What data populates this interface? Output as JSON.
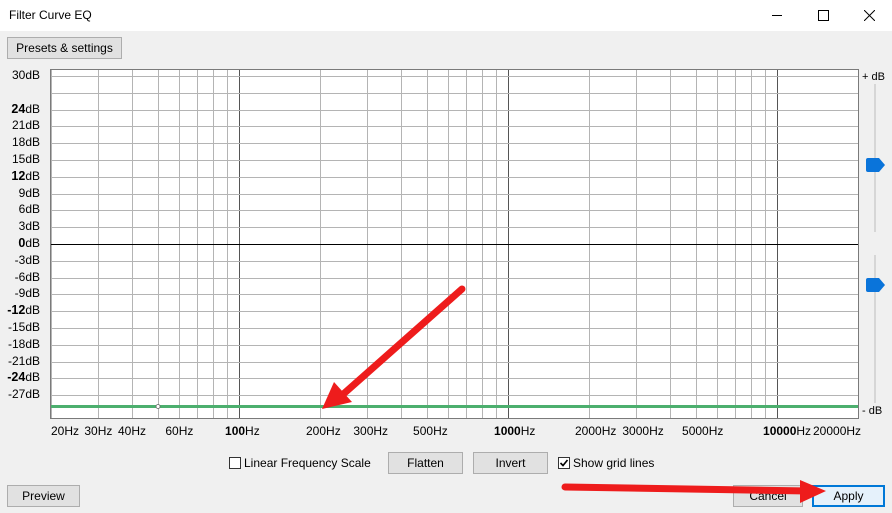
{
  "window": {
    "title": "Filter Curve EQ"
  },
  "toolbar": {
    "presets_label": "Presets & settings"
  },
  "y_axis": {
    "labels": [
      {
        "num": "30",
        "unit": "dB",
        "major": false
      },
      {
        "num": "24",
        "unit": "dB",
        "major": true
      },
      {
        "num": "21",
        "unit": "dB",
        "major": false
      },
      {
        "num": "18",
        "unit": "dB",
        "major": false
      },
      {
        "num": "15",
        "unit": "dB",
        "major": false
      },
      {
        "num": "12",
        "unit": "dB",
        "major": true
      },
      {
        "num": "9",
        "unit": "dB",
        "major": false
      },
      {
        "num": "6",
        "unit": "dB",
        "major": false
      },
      {
        "num": "3",
        "unit": "dB",
        "major": false
      },
      {
        "num": "0",
        "unit": "dB",
        "major": true
      },
      {
        "num": "-3",
        "unit": "dB",
        "major": false
      },
      {
        "num": "-6",
        "unit": "dB",
        "major": false
      },
      {
        "num": "-9",
        "unit": "dB",
        "major": false
      },
      {
        "num": "-12",
        "unit": "dB",
        "major": true
      },
      {
        "num": "-15",
        "unit": "dB",
        "major": false
      },
      {
        "num": "-18",
        "unit": "dB",
        "major": false
      },
      {
        "num": "-21",
        "unit": "dB",
        "major": false
      },
      {
        "num": "-24",
        "unit": "dB",
        "major": true
      },
      {
        "num": "-27",
        "unit": "dB",
        "major": false
      }
    ]
  },
  "x_axis": {
    "labels": [
      {
        "num": "20",
        "unit": "Hz",
        "major": false
      },
      {
        "num": "30",
        "unit": "Hz",
        "major": false
      },
      {
        "num": "40",
        "unit": "Hz",
        "major": false
      },
      {
        "num": "60",
        "unit": "Hz",
        "major": false
      },
      {
        "num": "100",
        "unit": "Hz",
        "major": true
      },
      {
        "num": "200",
        "unit": "Hz",
        "major": false
      },
      {
        "num": "300",
        "unit": "Hz",
        "major": false
      },
      {
        "num": "500",
        "unit": "Hz",
        "major": false
      },
      {
        "num": "1000",
        "unit": "Hz",
        "major": true
      },
      {
        "num": "2000",
        "unit": "Hz",
        "major": false
      },
      {
        "num": "3000",
        "unit": "Hz",
        "major": false
      },
      {
        "num": "5000",
        "unit": "Hz",
        "major": false
      },
      {
        "num": "10000",
        "unit": "Hz",
        "major": true
      },
      {
        "num": "20000",
        "unit": "Hz",
        "major": false
      }
    ]
  },
  "side": {
    "plus_db": "+ dB",
    "minus_db": "- dB"
  },
  "controls": {
    "linear_scale_label": "Linear Frequency Scale",
    "linear_scale_checked": false,
    "flatten_label": "Flatten",
    "invert_label": "Invert",
    "grid_label": "Show grid lines",
    "grid_checked": true
  },
  "footer": {
    "preview_label": "Preview",
    "cancel_label": "Cancel",
    "apply_label": "Apply"
  },
  "colors": {
    "curve": "#4caf6e",
    "arrow": "#ee1c1c",
    "slider": "#0a74da",
    "focus": "#0078d7"
  },
  "icons": [
    "minimize-icon",
    "maximize-icon",
    "close-icon",
    "slider-thumb-icon",
    "red-arrow-annotation",
    "checkmark-icon"
  ]
}
